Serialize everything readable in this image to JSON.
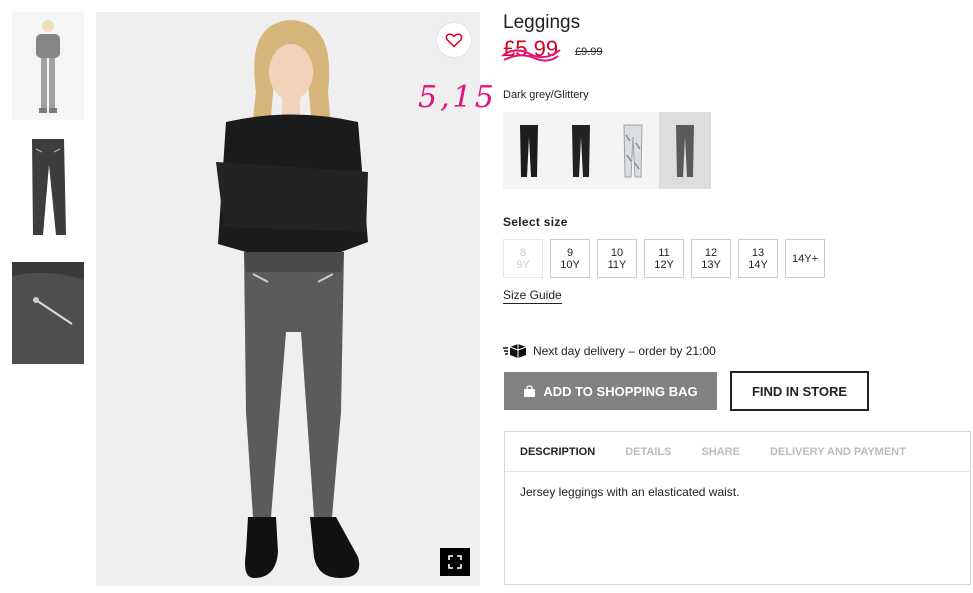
{
  "product": {
    "title": "Leggings",
    "price": "£5.99",
    "old_price": "£9.99",
    "handwritten_note": "5,15",
    "color_name": "Dark grey/Glittery"
  },
  "swatches": [
    {
      "name": "Black",
      "color": "#1c1c1c"
    },
    {
      "name": "Black",
      "color": "#222222"
    },
    {
      "name": "Light patterned",
      "color": "#dcdfe2"
    },
    {
      "name": "Dark grey/Glittery",
      "color": "#5a5a5a",
      "selected": true
    }
  ],
  "sizes": {
    "label": "Select size",
    "options": [
      {
        "a": "8",
        "b": "9Y",
        "disabled": true
      },
      {
        "a": "9",
        "b": "10Y"
      },
      {
        "a": "10",
        "b": "11Y"
      },
      {
        "a": "11",
        "b": "12Y"
      },
      {
        "a": "12",
        "b": "13Y"
      },
      {
        "a": "13",
        "b": "14Y"
      },
      {
        "a": "14Y+",
        "b": ""
      }
    ],
    "guide": "Size Guide"
  },
  "delivery": {
    "text": "Next day delivery – order by 21:00"
  },
  "buttons": {
    "add_to_bag": "ADD TO SHOPPING BAG",
    "find_in_store": "FIND IN STORE"
  },
  "tabs": [
    "DESCRIPTION",
    "DETAILS",
    "SHARE",
    "DELIVERY AND PAYMENT"
  ],
  "description": "Jersey leggings with an elasticated waist.",
  "icons": {
    "favorite": "heart-icon",
    "expand": "expand-icon",
    "delivery": "truck-icon",
    "bag": "shopping-bag-icon"
  },
  "colors": {
    "sale": "#d6001c",
    "note": "#e3127f",
    "button_grey": "#828282"
  }
}
